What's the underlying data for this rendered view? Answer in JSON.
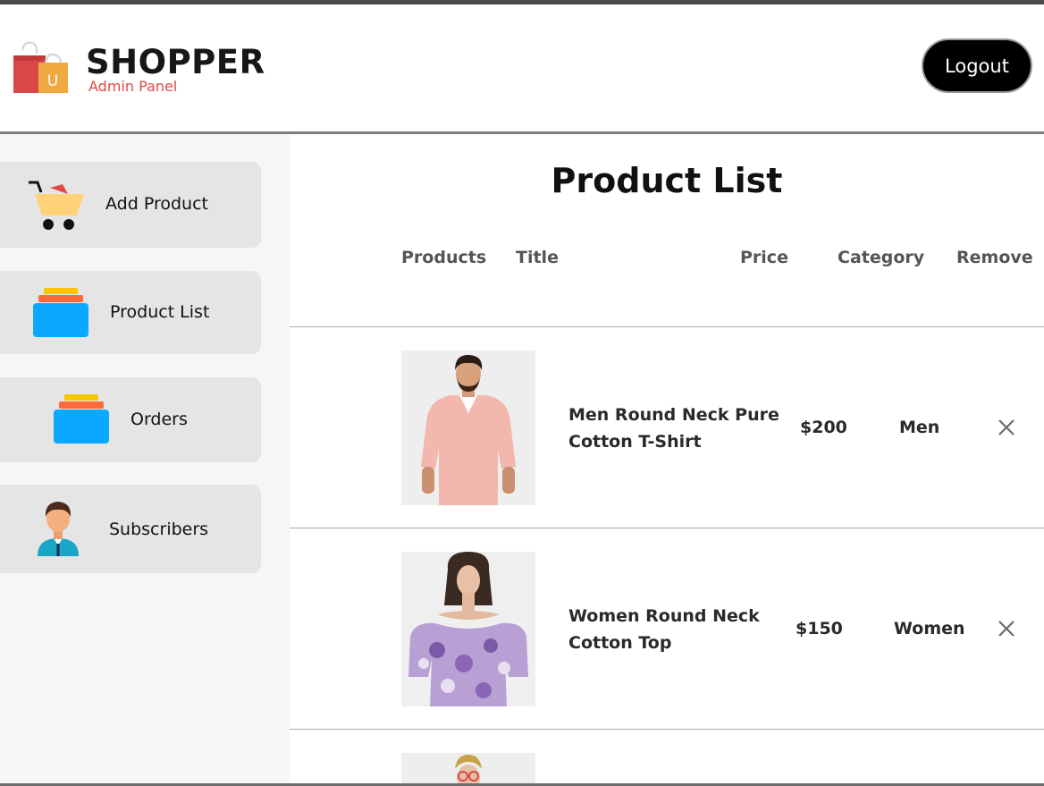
{
  "brand": {
    "title": "SHOPPER",
    "subtitle": "Admin Panel",
    "logo_icon": "shopping-bags-icon",
    "logo_letter": "U"
  },
  "navbar": {
    "logout_label": "Logout"
  },
  "sidebar": {
    "items": [
      {
        "label": "Add Product",
        "icon": "cart-icon"
      },
      {
        "label": "Product List",
        "icon": "stack-icon"
      },
      {
        "label": "Orders",
        "icon": "stack-icon"
      },
      {
        "label": "Subscribers",
        "icon": "user-avatar-icon"
      }
    ]
  },
  "main": {
    "title": "Product List",
    "columns": [
      "Products",
      "Title",
      "Price",
      "Category",
      "Remove"
    ],
    "rows": [
      {
        "title": "Men Round Neck Pure Cotton T-Shirt",
        "price": "$200",
        "category": "Men",
        "image": "man-pink-polo-photo"
      },
      {
        "title": "Women Round Neck Cotton Top",
        "price": "$150",
        "category": "Women",
        "image": "woman-floral-top-photo"
      },
      {
        "title": "",
        "price": "",
        "category": "",
        "image": "woman-partial-photo"
      }
    ]
  },
  "colors": {
    "brand_red": "#e04848",
    "logout_bg": "#000000",
    "sidebar_bg": "#f6f6f6",
    "sidebar_item_bg": "#e5e5e5",
    "header_text": "#555555"
  }
}
